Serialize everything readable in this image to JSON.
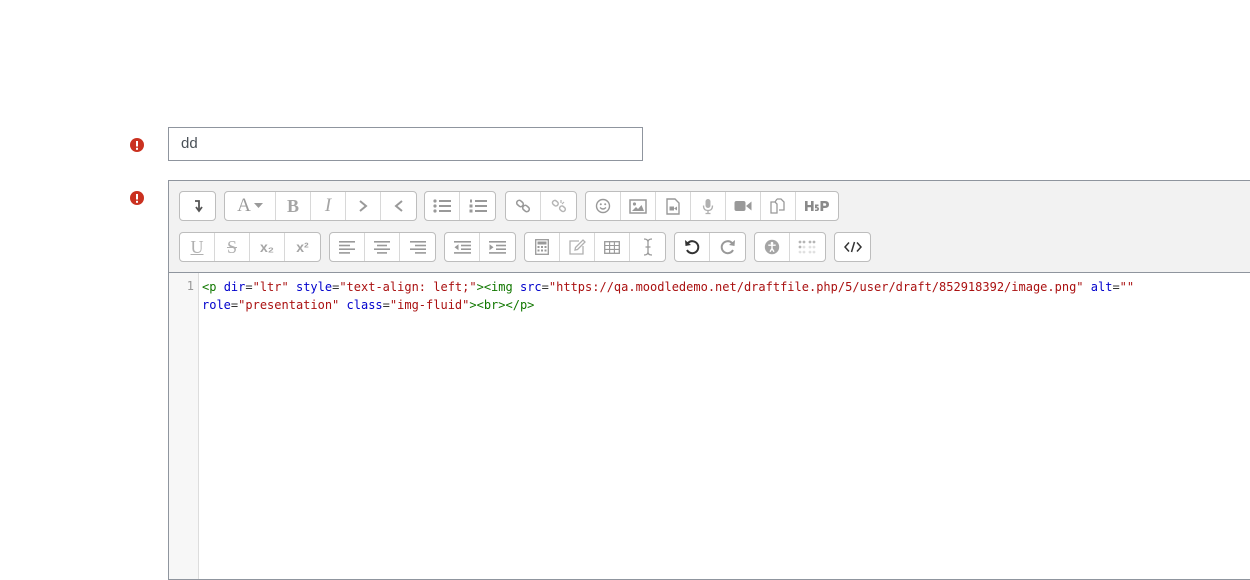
{
  "form": {
    "name_value": "dd"
  },
  "editor": {
    "line_number": "1",
    "code": {
      "p_open": "<p",
      "dir_attr": "dir",
      "dir_val": "\"ltr\"",
      "style_attr": "style",
      "style_val": "\"text-align: left;\"",
      "gt_img": "><img",
      "src_attr": "src",
      "src_val": "\"https://qa.moodledemo.net/draftfile.php/5/user/draft/852918392/image.png\"",
      "alt_attr": "alt",
      "alt_val": "\"\"",
      "role_attr": "role",
      "role_val": "\"presentation\"",
      "class_attr": "class",
      "class_val": "\"img-fluid\"",
      "tail": "><br></p>",
      "eq": "="
    },
    "toolbar_buttons": {
      "text_style": "A",
      "bold": "B",
      "italic": "I",
      "underline": "U",
      "strike": "S",
      "subscript": "x₂",
      "superscript": "x²"
    }
  },
  "colors": {
    "error": "#ca3120",
    "tag": "#117700",
    "attribute": "#0000cc",
    "string": "#aa1111"
  }
}
